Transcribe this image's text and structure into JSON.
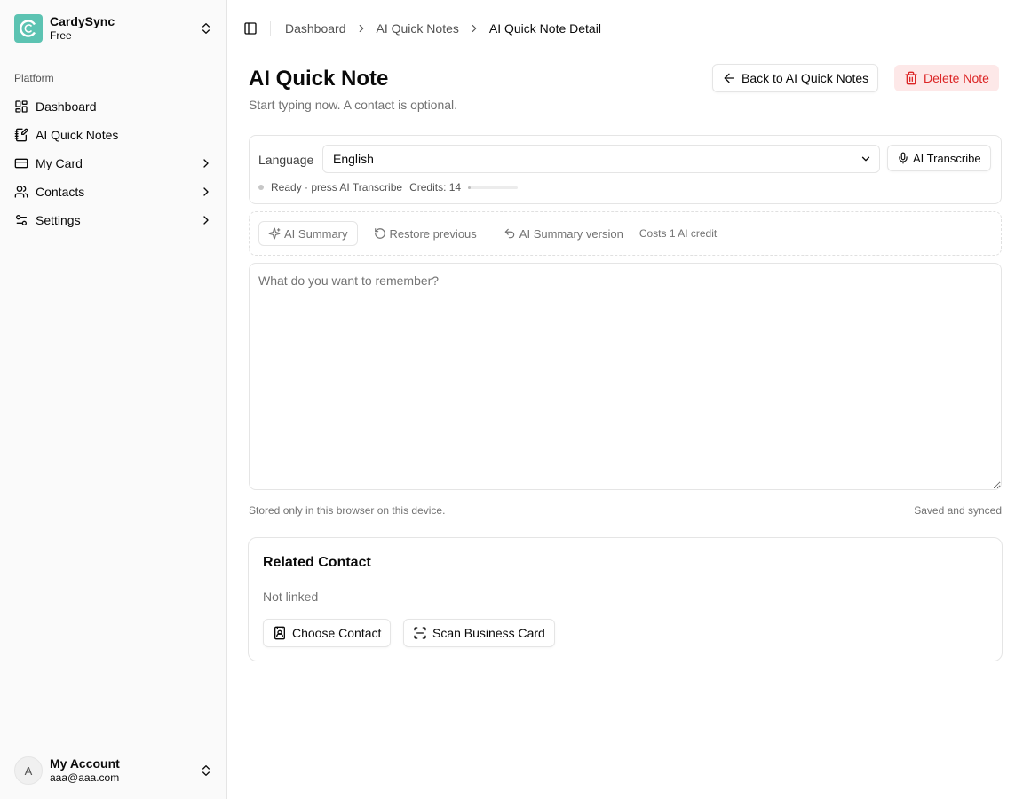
{
  "app": {
    "name": "CardySync",
    "plan": "Free"
  },
  "sidebar": {
    "group_label": "Platform",
    "items": [
      {
        "label": "Dashboard",
        "icon": "dashboard-icon"
      },
      {
        "label": "AI Quick Notes",
        "icon": "notebook-pen-icon"
      },
      {
        "label": "My Card",
        "icon": "card-icon"
      },
      {
        "label": "Contacts",
        "icon": "users-icon"
      },
      {
        "label": "Settings",
        "icon": "sliders-icon"
      }
    ],
    "account": {
      "initial": "A",
      "name": "My Account",
      "email": "aaa@aaa.com"
    }
  },
  "breadcrumb": [
    "Dashboard",
    "AI Quick Notes",
    "AI Quick Note Detail"
  ],
  "page": {
    "title": "AI Quick Note",
    "subtitle": "Start typing now. A contact is optional.",
    "back_label": "Back to AI Quick Notes",
    "delete_label": "Delete Note"
  },
  "language": {
    "label": "Language",
    "selected": "English",
    "transcribe_label": "AI Transcribe",
    "status": "Ready · press AI Transcribe",
    "credits": "Credits: 14",
    "credit_level": 0.05
  },
  "summary": {
    "summary_label": "AI Summary",
    "restore_label": "Restore previous",
    "version_label": "AI Summary version",
    "cost": "Costs 1 AI credit"
  },
  "note": {
    "value": "",
    "placeholder": "What do you want to remember?",
    "storage_hint": "Stored only in this browser on this device.",
    "sync_status": "Saved and synced"
  },
  "related_contact": {
    "title": "Related Contact",
    "status": "Not linked",
    "choose_label": "Choose Contact",
    "scan_label": "Scan Business Card"
  },
  "colors": {
    "brand": "#5cc3b2",
    "danger": "#dc2626",
    "danger_bg": "#fde8e8"
  }
}
